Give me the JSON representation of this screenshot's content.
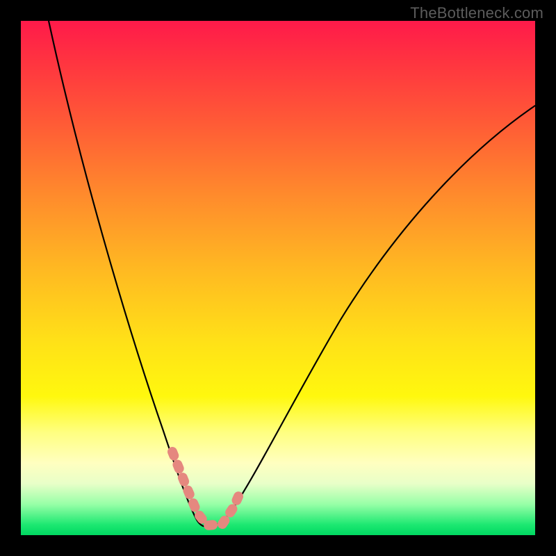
{
  "attribution": "TheBottleneck.com",
  "colors": {
    "gradient_top": "#FF1A4A",
    "gradient_bottom": "#00D761",
    "curve": "#000000",
    "highlight": "#E5887F",
    "frame": "#000000"
  },
  "chart_data": {
    "type": "line",
    "title": "",
    "xlabel": "",
    "ylabel": "",
    "xlim": [
      0,
      100
    ],
    "ylim": [
      0,
      100
    ],
    "series": [
      {
        "name": "bottleneck-curve",
        "x": [
          5,
          8,
          11,
          14,
          17,
          20,
          23,
          25,
          27,
          29,
          31,
          33,
          35,
          37,
          40,
          45,
          50,
          55,
          60,
          65,
          70,
          75,
          80,
          85,
          90,
          95,
          100
        ],
        "values": [
          100,
          86,
          74,
          62,
          52,
          42,
          33,
          26,
          20,
          14,
          9,
          5,
          2,
          1,
          1,
          3,
          8,
          15,
          23,
          32,
          41,
          50,
          58,
          66,
          73,
          79,
          84
        ]
      }
    ],
    "highlight_range_x": [
      29,
      41
    ],
    "annotations": []
  }
}
